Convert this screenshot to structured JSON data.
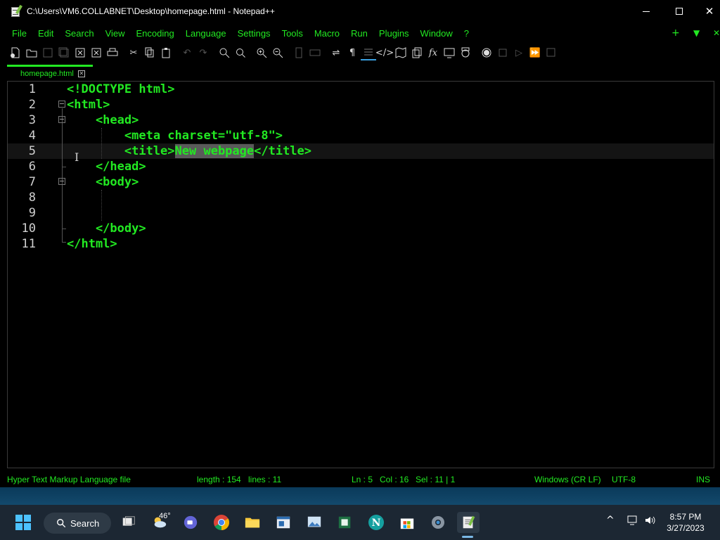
{
  "window": {
    "title": "C:\\Users\\VM6.COLLABNET\\Desktop\\homepage.html - Notepad++"
  },
  "menu": [
    "File",
    "Edit",
    "Search",
    "View",
    "Encoding",
    "Language",
    "Settings",
    "Tools",
    "Macro",
    "Run",
    "Plugins",
    "Window",
    "?"
  ],
  "menu_right": {
    "plus": "+",
    "down": "▼",
    "close": "✕"
  },
  "tab": {
    "label": "homepage.html",
    "close": "✕"
  },
  "editor": {
    "line_numbers": [
      "1",
      "2",
      "3",
      "4",
      "5",
      "6",
      "7",
      "8",
      "9",
      "10",
      "11"
    ],
    "lines": [
      "<!DOCTYPE html>",
      "<html>",
      "    <head>",
      "        <meta charset=\"utf-8\">",
      "        <title>",
      "    </head>",
      "    <body>",
      "",
      "",
      "    </body>",
      "</html>"
    ],
    "selected_text": "New webpage",
    "line5_after": "</title>"
  },
  "status": {
    "file_type": "Hyper Text Markup Language file",
    "length": "length : 154",
    "lines": "lines : 11",
    "ln": "Ln : 5",
    "col": "Col : 16",
    "sel": "Sel : 11 | 1",
    "eol": "Windows (CR LF)",
    "encoding": "UTF-8",
    "mode": "INS"
  },
  "taskbar": {
    "search_label": "Search",
    "weather_temp": "46°",
    "time": "8:57 PM",
    "date": "3/27/2023"
  },
  "colors": {
    "text": "#22e922",
    "background": "#000000",
    "selection": "#5a5a5a",
    "taskbar": "#1c2733"
  }
}
